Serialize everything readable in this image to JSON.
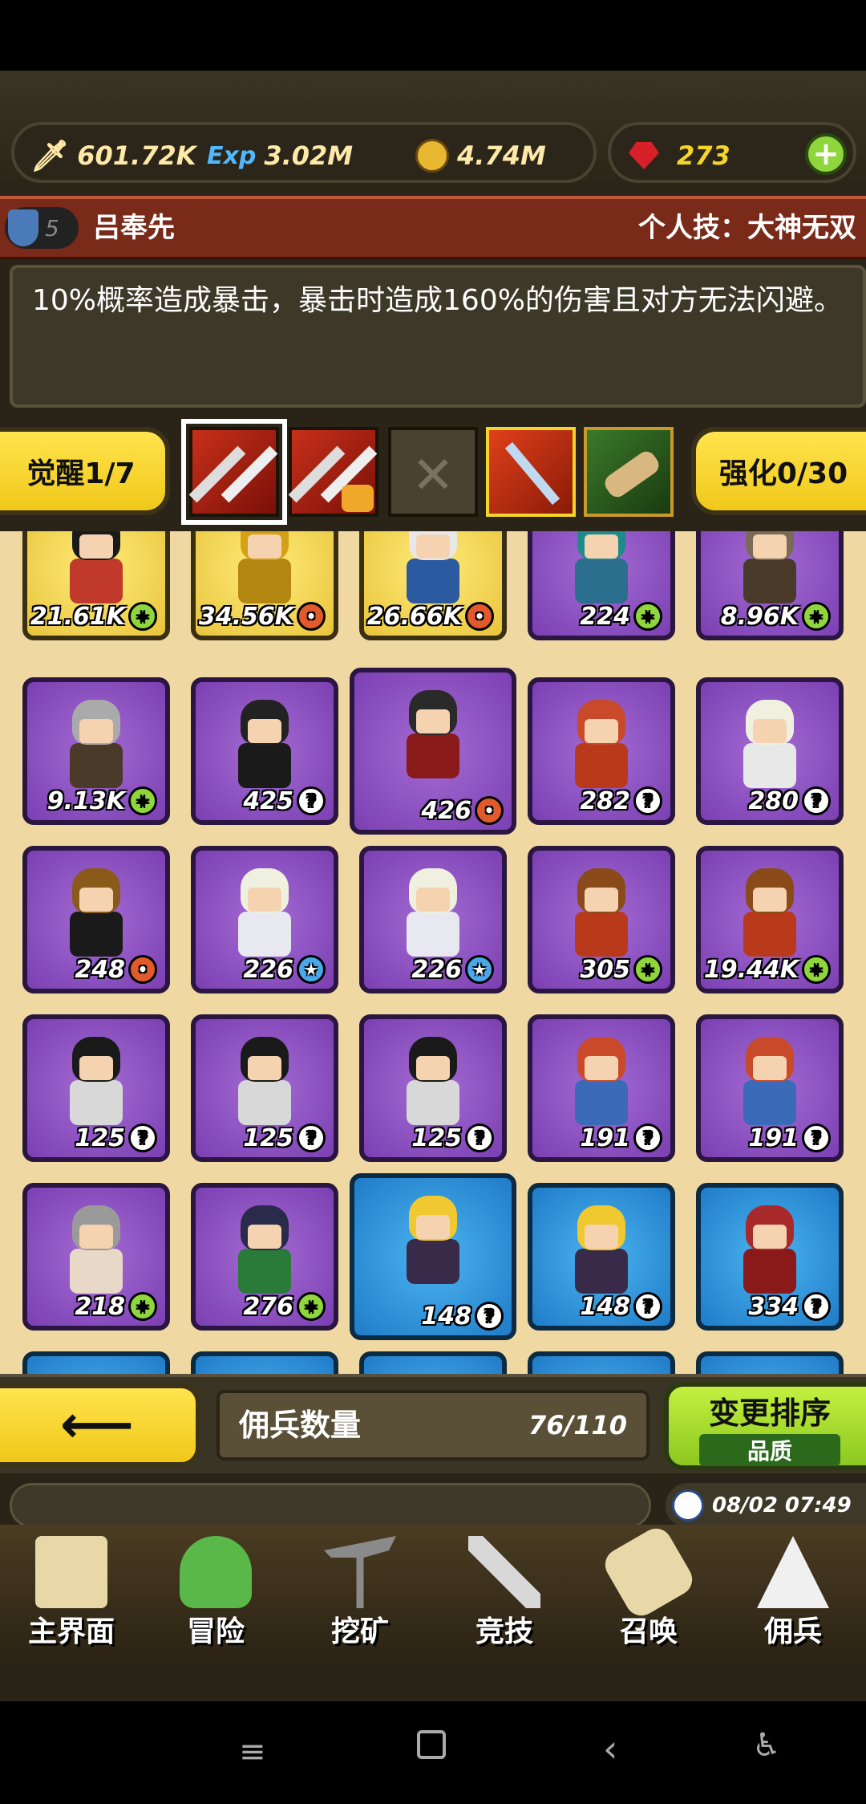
{
  "resources": {
    "attack": "601.72K",
    "exp_label": "Exp",
    "exp": "3.02M",
    "gold": "4.74M",
    "gems": "273"
  },
  "hero": {
    "rank": "5",
    "name": "吕奉先",
    "skill_label": "个人技：大神无双",
    "description": "10%概率造成暴击，暴击时造成160%的伤害且对方无法闪避。"
  },
  "buttons": {
    "awaken": "觉醒1/7",
    "enhance": "强化0/30",
    "sort": "变更排序",
    "sort_mode": "品质"
  },
  "mercenary_count_label": "佣兵数量",
  "mercenary_count": "76/110",
  "clock": "08/02 07:49",
  "cards": [
    {
      "frame": "yellow",
      "level": "21.61K",
      "badge": "+",
      "hair": "#1a1a1a",
      "outfit": "#c0392b"
    },
    {
      "frame": "yellow",
      "level": "34.56K",
      "badge": "•",
      "hair": "#d4a017",
      "outfit": "#b38612"
    },
    {
      "frame": "yellow",
      "level": "26.66K",
      "badge": "•",
      "hair": "#e8e8e8",
      "outfit": "#2c5aa0"
    },
    {
      "frame": "purple",
      "level": "224",
      "badge": "+",
      "hair": "#1f8a8a",
      "outfit": "#2c6e8e"
    },
    {
      "frame": "purple",
      "level": "8.96K",
      "badge": "+",
      "hair": "#7a6a5a",
      "outfit": "#4a3a2a"
    },
    {
      "frame": "purple",
      "level": "9.13K",
      "badge": "+",
      "hair": "#aaaaaa",
      "outfit": "#4a3a2a"
    },
    {
      "frame": "purple",
      "level": "425",
      "badge": "?",
      "hair": "#222222",
      "outfit": "#1a1a1a"
    },
    {
      "frame": "purple",
      "level": "426",
      "badge": "•",
      "hair": "#2a2a2a",
      "outfit": "#8a1a1a"
    },
    {
      "frame": "purple",
      "level": "282",
      "badge": "?",
      "hair": "#c84a2a",
      "outfit": "#b83a1a"
    },
    {
      "frame": "purple",
      "level": "280",
      "badge": "?",
      "hair": "#f0f0e0",
      "outfit": "#e8e8e8"
    },
    {
      "frame": "purple",
      "level": "248",
      "badge": "•",
      "hair": "#8a5a1a",
      "outfit": "#1a1a1a"
    },
    {
      "frame": "purple",
      "level": "226",
      "badge": "★",
      "hair": "#f0f0e0",
      "outfit": "#e8e8f0"
    },
    {
      "frame": "purple",
      "level": "226",
      "badge": "★",
      "hair": "#f0f0e0",
      "outfit": "#e8e8f0"
    },
    {
      "frame": "purple",
      "level": "305",
      "badge": "+",
      "hair": "#8a4a1a",
      "outfit": "#b83a1a"
    },
    {
      "frame": "purple",
      "level": "19.44K",
      "badge": "+",
      "hair": "#8a4a1a",
      "outfit": "#b83a1a"
    },
    {
      "frame": "purple",
      "level": "125",
      "badge": "?",
      "hair": "#1a1a1a",
      "outfit": "#d8d8d8"
    },
    {
      "frame": "purple",
      "level": "125",
      "badge": "?",
      "hair": "#1a1a1a",
      "outfit": "#d8d8d8"
    },
    {
      "frame": "purple",
      "level": "125",
      "badge": "?",
      "hair": "#1a1a1a",
      "outfit": "#d8d8d8"
    },
    {
      "frame": "purple",
      "level": "191",
      "badge": "?",
      "hair": "#c84a2a",
      "outfit": "#3a6ab8"
    },
    {
      "frame": "purple",
      "level": "191",
      "badge": "?",
      "hair": "#c84a2a",
      "outfit": "#3a6ab8"
    },
    {
      "frame": "purple",
      "level": "218",
      "badge": "+",
      "hair": "#9a9a9a",
      "outfit": "#e8d8c8"
    },
    {
      "frame": "purple",
      "level": "276",
      "badge": "+",
      "hair": "#2a2a4a",
      "outfit": "#2a7a3a"
    },
    {
      "frame": "blue",
      "level": "148",
      "badge": "?",
      "hair": "#f0c830",
      "outfit": "#3a2a4a"
    },
    {
      "frame": "blue",
      "level": "148",
      "badge": "?",
      "hair": "#f0c830",
      "outfit": "#3a2a4a"
    },
    {
      "frame": "blue",
      "level": "334",
      "badge": "?",
      "hair": "#a82a2a",
      "outfit": "#8a1a1a"
    }
  ],
  "nav": [
    {
      "label": "主界面",
      "icon": "map-scroll-icon"
    },
    {
      "label": "冒险",
      "icon": "island-icon"
    },
    {
      "label": "挖矿",
      "icon": "pickaxe-icon"
    },
    {
      "label": "竞技",
      "icon": "crossed-swords-icon"
    },
    {
      "label": "召唤",
      "icon": "summon-scroll-icon"
    },
    {
      "label": "佣兵",
      "icon": "tent-icon"
    }
  ],
  "colors": {
    "accent_yellow": "#f5d52a",
    "accent_green": "#9be03a",
    "name_bar": "#7a2a18",
    "grid_bg": "#f0d8a2"
  }
}
